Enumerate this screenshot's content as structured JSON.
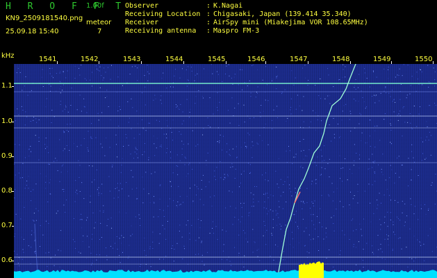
{
  "header": {
    "app_title": "H R O F F T",
    "version": "1.00f",
    "filename": "KN9_2509181540.png",
    "meteor_label": "meteor",
    "datetime": "25.09.18 15:40",
    "meteor_count": "7",
    "info": [
      {
        "label": "Observer",
        "value": "K.Nagai"
      },
      {
        "label": "Receiving Location",
        "value": "Chigasaki, Japan (139.414 35.340)"
      },
      {
        "label": "Receiver",
        "value": "AirSpy mini (Miakejima VOR 108.65MHz)"
      },
      {
        "label": "Receiving antenna",
        "value": "Maspro FM-3"
      }
    ]
  },
  "axis": {
    "unit": "kHz",
    "x_ticks": [
      "1541",
      "1542",
      "1543",
      "1544",
      "1545",
      "1546",
      "1547",
      "1548",
      "1549",
      "1550"
    ],
    "y_ticks": [
      "1.1",
      "1.0",
      "0.9",
      "0.8",
      "0.7",
      "0.6"
    ]
  },
  "colors": {
    "background": "#1a2a88",
    "header_text": "#ffff40",
    "title_green": "#2ec82e",
    "carrier_line": "#7fffd4",
    "meteor_trace": "#a0ffd8",
    "noise_floor": "#00e0ff",
    "burst": "#ffff00"
  }
}
